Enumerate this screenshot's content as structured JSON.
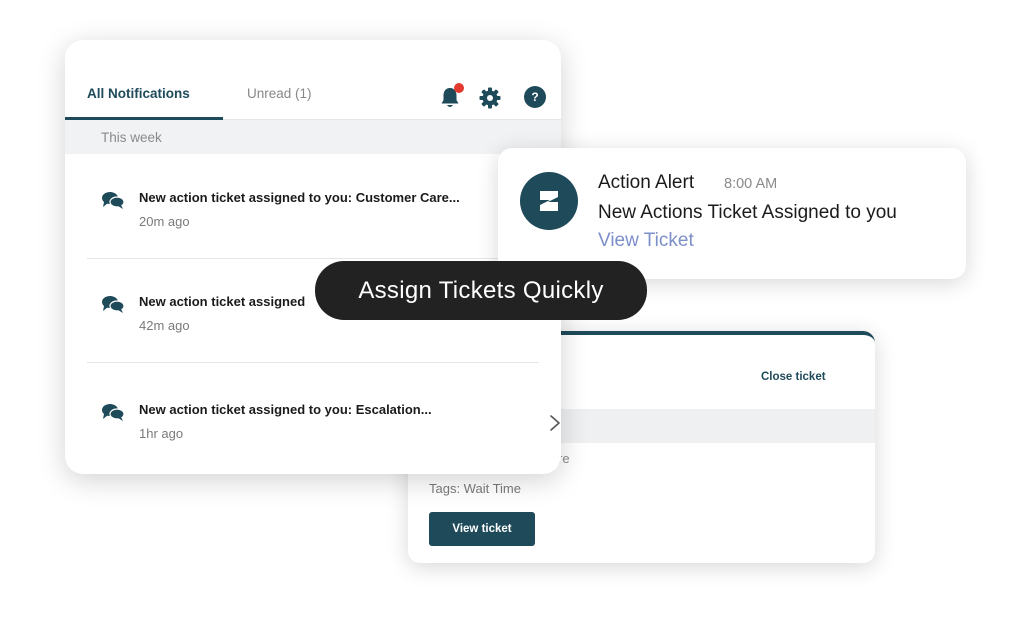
{
  "ticket_card": {
    "close_label": "Close ticket",
    "partial_text": "re",
    "tags": "Tags: Wait Time",
    "view_button": "View ticket"
  },
  "notifications": {
    "tabs": [
      {
        "label": "All Notifications",
        "active": true
      },
      {
        "label": "Unread (1)",
        "active": false
      }
    ],
    "icons": [
      "bell-icon",
      "gear-icon",
      "help-icon"
    ],
    "help_glyph": "?",
    "section_label": "This week",
    "items": [
      {
        "title": "New action ticket assigned to you: Customer Care...",
        "time": "20m ago"
      },
      {
        "title": "New action ticket assigned",
        "time": "42m ago"
      },
      {
        "title": "New action ticket assigned to you: Escalation...",
        "time": "1hr ago"
      }
    ]
  },
  "alert": {
    "title": "Action Alert",
    "time": "8:00 AM",
    "message": "New Actions Ticket Assigned to you",
    "link": "View Ticket"
  },
  "tooltip": {
    "text": "Assign Tickets Quickly"
  },
  "colors": {
    "brand": "#1f4a5a",
    "notification_dot": "#e23a2e",
    "link": "#7d8fc9",
    "pill": "#222222"
  }
}
